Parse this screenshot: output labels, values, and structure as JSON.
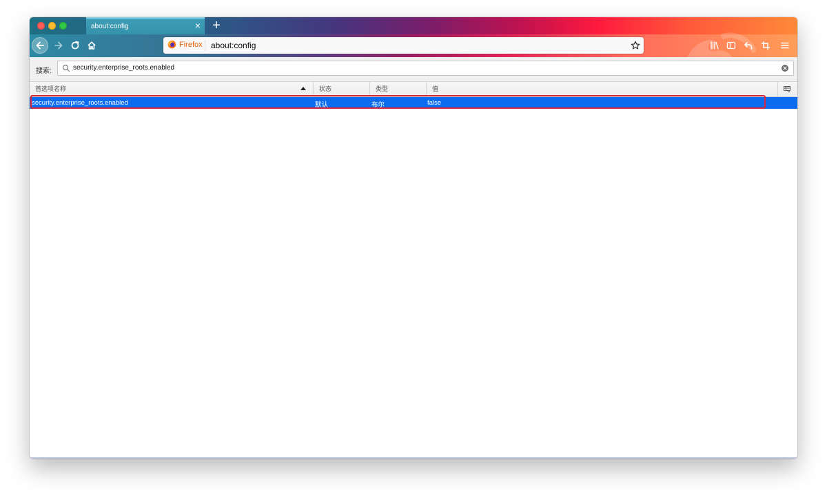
{
  "tab": {
    "title": "about:config",
    "close": "×"
  },
  "new_tab": "+",
  "urlbar": {
    "identity_label": "Firefox",
    "url": "about:config"
  },
  "search": {
    "label": "搜索:",
    "value": "security.enterprise_roots.enabled"
  },
  "columns": {
    "name": "首选项名称",
    "status": "状态",
    "type": "类型",
    "value": "值"
  },
  "rows": [
    {
      "name": "security.enterprise_roots.enabled",
      "status": "默认",
      "type": "布尔",
      "value": "false"
    }
  ],
  "colors": {
    "selected_row": "#0b6cf0",
    "highlight_box": "#d8283b",
    "firefox_orange": "#e66000"
  },
  "icons": {
    "nav": [
      "back-arrow-icon",
      "forward-arrow-icon",
      "reload-icon",
      "home-icon"
    ],
    "toolbar": [
      "library-icon",
      "sidebar-icon",
      "undo-icon",
      "screenshot-icon",
      "hamburger-menu-icon"
    ],
    "other": [
      "search-icon",
      "clear-icon",
      "bookmark-star-icon",
      "firefox-logo-icon",
      "column-picker-icon"
    ]
  }
}
